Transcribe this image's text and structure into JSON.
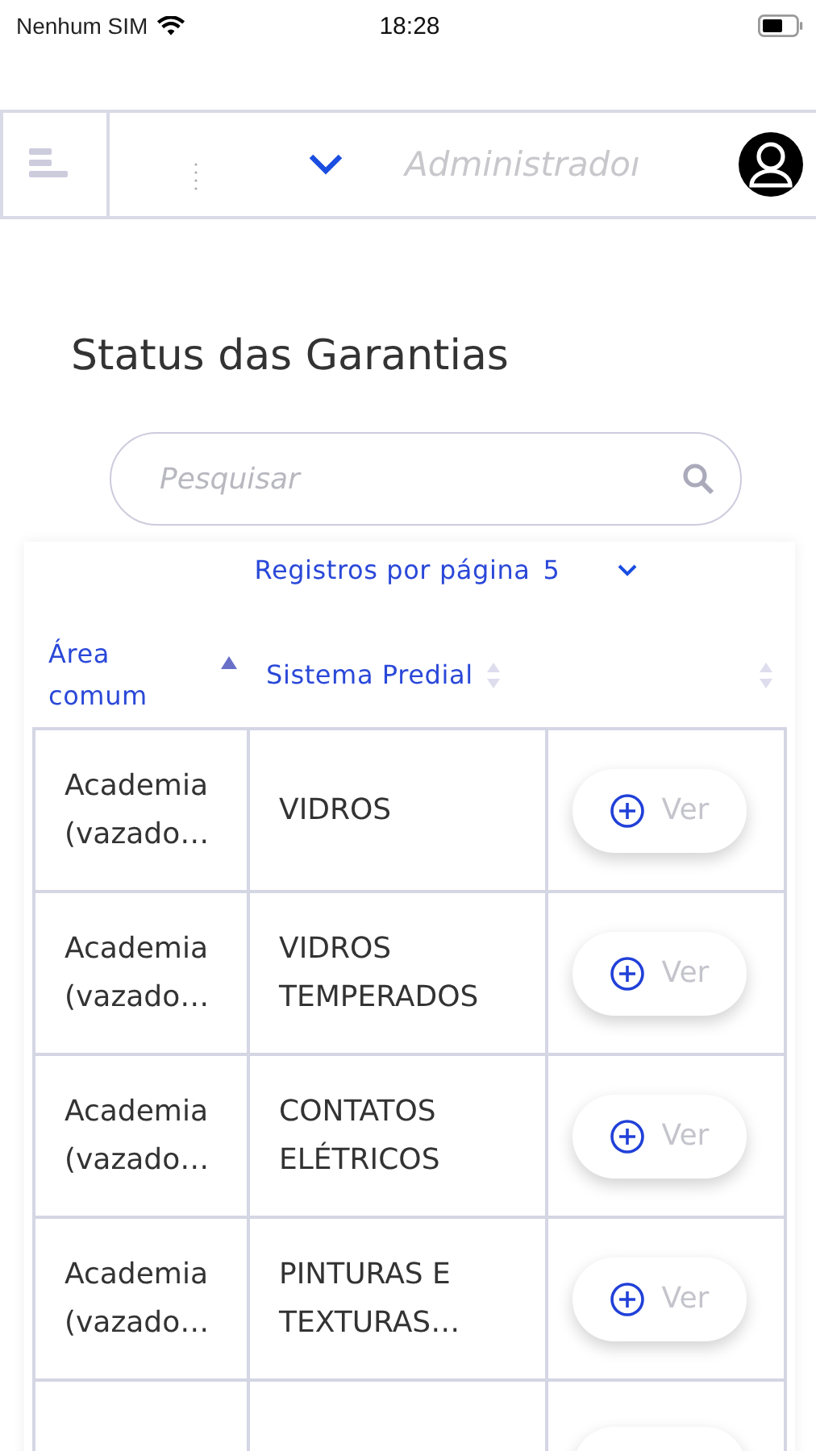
{
  "status_bar": {
    "carrier": "Nenhum SIM",
    "time": "18:28"
  },
  "header": {
    "user": "Administradoı"
  },
  "title": "Status das Garantias",
  "search": {
    "placeholder": "Pesquisar"
  },
  "pagination": {
    "label": "Registros por página",
    "value": "5"
  },
  "table": {
    "columns": [
      {
        "label": "Área comum",
        "sorted": true
      },
      {
        "label": "Sistema Predial",
        "sorted": false
      },
      {
        "sorted": false
      }
    ],
    "rows": [
      {
        "area": "Academia (vazado…",
        "system": "VIDROS",
        "action": "Ver"
      },
      {
        "area": "Academia (vazado…",
        "system": "VIDROS TEMPERADOS",
        "action": "Ver"
      },
      {
        "area": "Academia (vazado…",
        "system": "CONTATOS ELÉTRICOS",
        "action": "Ver"
      },
      {
        "area": "Academia (vazado…",
        "system": "PINTURAS E TEXTURAS…",
        "action": "Ver"
      }
    ]
  }
}
